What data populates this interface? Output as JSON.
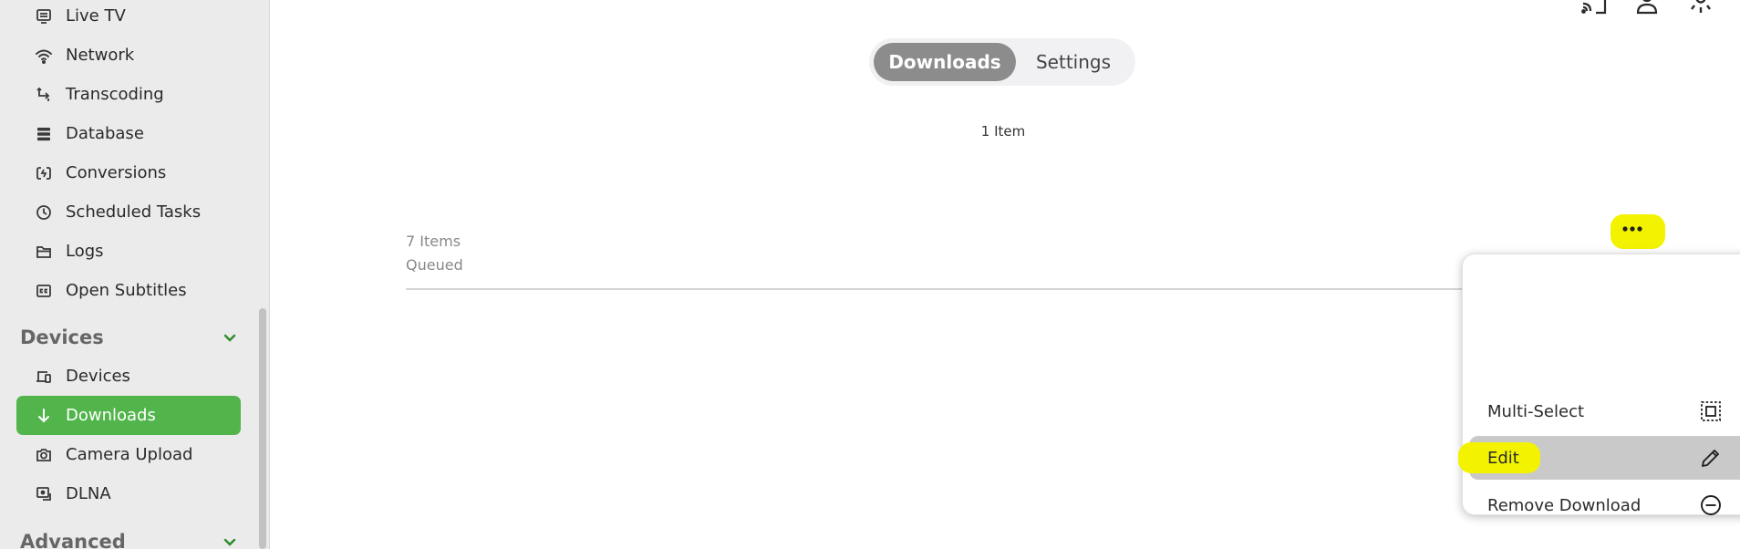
{
  "sidebar": {
    "items": [
      {
        "label": "Live TV",
        "icon": "tv-icon"
      },
      {
        "label": "Network",
        "icon": "wifi-icon"
      },
      {
        "label": "Transcoding",
        "icon": "transcode-icon"
      },
      {
        "label": "Database",
        "icon": "database-icon"
      },
      {
        "label": "Conversions",
        "icon": "sync-icon"
      },
      {
        "label": "Scheduled Tasks",
        "icon": "clock-icon"
      },
      {
        "label": "Logs",
        "icon": "folder-icon"
      },
      {
        "label": "Open Subtitles",
        "icon": "subtitles-icon"
      }
    ],
    "devices_section": "Devices",
    "device_items": [
      {
        "label": "Devices",
        "icon": "devices-icon"
      },
      {
        "label": "Downloads",
        "icon": "download-icon",
        "active": true
      },
      {
        "label": "Camera Upload",
        "icon": "camera-icon"
      },
      {
        "label": "DLNA",
        "icon": "dlna-icon"
      }
    ],
    "advanced_section": "Advanced"
  },
  "tabs": {
    "downloads": "Downloads",
    "settings": "Settings"
  },
  "downloads": {
    "count": "1 Item",
    "row": {
      "items": "7 Items",
      "status": "Queued"
    }
  },
  "menu": {
    "multi_select": "Multi-Select",
    "edit": "Edit",
    "remove": "Remove Download"
  },
  "colors": {
    "accent": "#52b54b",
    "highlight": "#f3f300"
  }
}
